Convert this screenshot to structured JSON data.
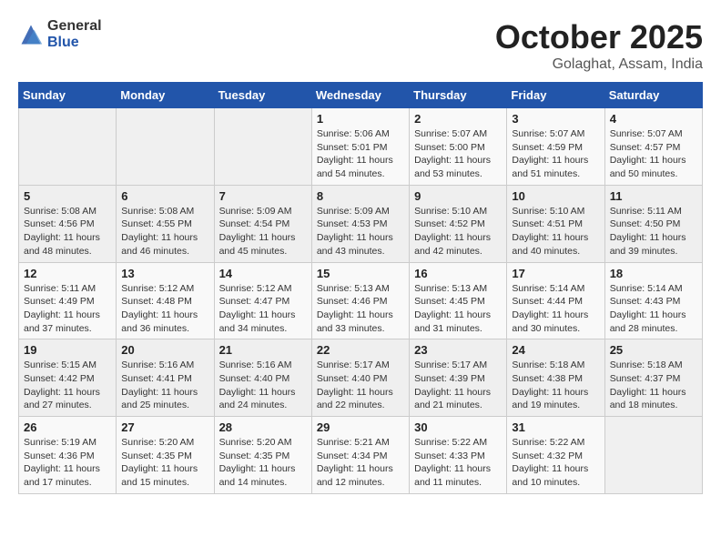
{
  "header": {
    "logo_general": "General",
    "logo_blue": "Blue",
    "title": "October 2025",
    "subtitle": "Golaghat, Assam, India"
  },
  "days_of_week": [
    "Sunday",
    "Monday",
    "Tuesday",
    "Wednesday",
    "Thursday",
    "Friday",
    "Saturday"
  ],
  "weeks": [
    [
      {
        "day": "",
        "info": ""
      },
      {
        "day": "",
        "info": ""
      },
      {
        "day": "",
        "info": ""
      },
      {
        "day": "1",
        "info": "Sunrise: 5:06 AM\nSunset: 5:01 PM\nDaylight: 11 hours\nand 54 minutes."
      },
      {
        "day": "2",
        "info": "Sunrise: 5:07 AM\nSunset: 5:00 PM\nDaylight: 11 hours\nand 53 minutes."
      },
      {
        "day": "3",
        "info": "Sunrise: 5:07 AM\nSunset: 4:59 PM\nDaylight: 11 hours\nand 51 minutes."
      },
      {
        "day": "4",
        "info": "Sunrise: 5:07 AM\nSunset: 4:57 PM\nDaylight: 11 hours\nand 50 minutes."
      }
    ],
    [
      {
        "day": "5",
        "info": "Sunrise: 5:08 AM\nSunset: 4:56 PM\nDaylight: 11 hours\nand 48 minutes."
      },
      {
        "day": "6",
        "info": "Sunrise: 5:08 AM\nSunset: 4:55 PM\nDaylight: 11 hours\nand 46 minutes."
      },
      {
        "day": "7",
        "info": "Sunrise: 5:09 AM\nSunset: 4:54 PM\nDaylight: 11 hours\nand 45 minutes."
      },
      {
        "day": "8",
        "info": "Sunrise: 5:09 AM\nSunset: 4:53 PM\nDaylight: 11 hours\nand 43 minutes."
      },
      {
        "day": "9",
        "info": "Sunrise: 5:10 AM\nSunset: 4:52 PM\nDaylight: 11 hours\nand 42 minutes."
      },
      {
        "day": "10",
        "info": "Sunrise: 5:10 AM\nSunset: 4:51 PM\nDaylight: 11 hours\nand 40 minutes."
      },
      {
        "day": "11",
        "info": "Sunrise: 5:11 AM\nSunset: 4:50 PM\nDaylight: 11 hours\nand 39 minutes."
      }
    ],
    [
      {
        "day": "12",
        "info": "Sunrise: 5:11 AM\nSunset: 4:49 PM\nDaylight: 11 hours\nand 37 minutes."
      },
      {
        "day": "13",
        "info": "Sunrise: 5:12 AM\nSunset: 4:48 PM\nDaylight: 11 hours\nand 36 minutes."
      },
      {
        "day": "14",
        "info": "Sunrise: 5:12 AM\nSunset: 4:47 PM\nDaylight: 11 hours\nand 34 minutes."
      },
      {
        "day": "15",
        "info": "Sunrise: 5:13 AM\nSunset: 4:46 PM\nDaylight: 11 hours\nand 33 minutes."
      },
      {
        "day": "16",
        "info": "Sunrise: 5:13 AM\nSunset: 4:45 PM\nDaylight: 11 hours\nand 31 minutes."
      },
      {
        "day": "17",
        "info": "Sunrise: 5:14 AM\nSunset: 4:44 PM\nDaylight: 11 hours\nand 30 minutes."
      },
      {
        "day": "18",
        "info": "Sunrise: 5:14 AM\nSunset: 4:43 PM\nDaylight: 11 hours\nand 28 minutes."
      }
    ],
    [
      {
        "day": "19",
        "info": "Sunrise: 5:15 AM\nSunset: 4:42 PM\nDaylight: 11 hours\nand 27 minutes."
      },
      {
        "day": "20",
        "info": "Sunrise: 5:16 AM\nSunset: 4:41 PM\nDaylight: 11 hours\nand 25 minutes."
      },
      {
        "day": "21",
        "info": "Sunrise: 5:16 AM\nSunset: 4:40 PM\nDaylight: 11 hours\nand 24 minutes."
      },
      {
        "day": "22",
        "info": "Sunrise: 5:17 AM\nSunset: 4:40 PM\nDaylight: 11 hours\nand 22 minutes."
      },
      {
        "day": "23",
        "info": "Sunrise: 5:17 AM\nSunset: 4:39 PM\nDaylight: 11 hours\nand 21 minutes."
      },
      {
        "day": "24",
        "info": "Sunrise: 5:18 AM\nSunset: 4:38 PM\nDaylight: 11 hours\nand 19 minutes."
      },
      {
        "day": "25",
        "info": "Sunrise: 5:18 AM\nSunset: 4:37 PM\nDaylight: 11 hours\nand 18 minutes."
      }
    ],
    [
      {
        "day": "26",
        "info": "Sunrise: 5:19 AM\nSunset: 4:36 PM\nDaylight: 11 hours\nand 17 minutes."
      },
      {
        "day": "27",
        "info": "Sunrise: 5:20 AM\nSunset: 4:35 PM\nDaylight: 11 hours\nand 15 minutes."
      },
      {
        "day": "28",
        "info": "Sunrise: 5:20 AM\nSunset: 4:35 PM\nDaylight: 11 hours\nand 14 minutes."
      },
      {
        "day": "29",
        "info": "Sunrise: 5:21 AM\nSunset: 4:34 PM\nDaylight: 11 hours\nand 12 minutes."
      },
      {
        "day": "30",
        "info": "Sunrise: 5:22 AM\nSunset: 4:33 PM\nDaylight: 11 hours\nand 11 minutes."
      },
      {
        "day": "31",
        "info": "Sunrise: 5:22 AM\nSunset: 4:32 PM\nDaylight: 11 hours\nand 10 minutes."
      },
      {
        "day": "",
        "info": ""
      }
    ]
  ]
}
